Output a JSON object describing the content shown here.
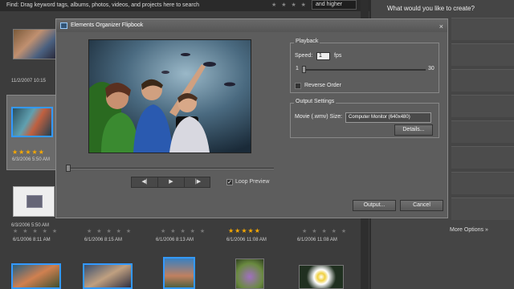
{
  "organizer": {
    "find_label": "Find: Drag keyword tags, albums, photos, videos, and projects here to search",
    "rating_stars": "★ ★ ★ ★ ★",
    "rating_filter": "and higher",
    "dates": {
      "d1": "11/2/2007 10:15",
      "d2": "6/3/2006 5:50 AM",
      "d3": "6/3/2006 5:50 AM",
      "r1": "6/1/2006 8:11 AM",
      "r2": "6/1/2006 8:15 AM",
      "r3": "6/1/2006 8:13 AM",
      "r4": "6/1/2006 11:08 AM",
      "r5": "6/1/2006 11:08 AM"
    },
    "empty_stars": "★ ★ ★ ★ ★",
    "gold_stars": "★★★★★"
  },
  "right_panel": {
    "question": "What would you like to create?",
    "more_options": "More Options »"
  },
  "dialog": {
    "title": "Elements Organizer Flipbook",
    "close": "×",
    "controls": {
      "prev": "◀|",
      "play": "▶",
      "next": "|▶"
    },
    "loop_label": "Loop Preview",
    "loop_checked": true,
    "playback": {
      "title": "Playback",
      "speed_label": "Speed:",
      "speed_value": "1",
      "fps_label": "fps",
      "min": "1",
      "max": "30",
      "reverse_label": "Reverse Order"
    },
    "output": {
      "title": "Output Settings",
      "size_label": "Movie (.wmv) Size:",
      "size_value": "Computer Monitor (640x480)",
      "details_button": "Details..."
    },
    "output_button": "Output...",
    "cancel_button": "Cancel"
  }
}
